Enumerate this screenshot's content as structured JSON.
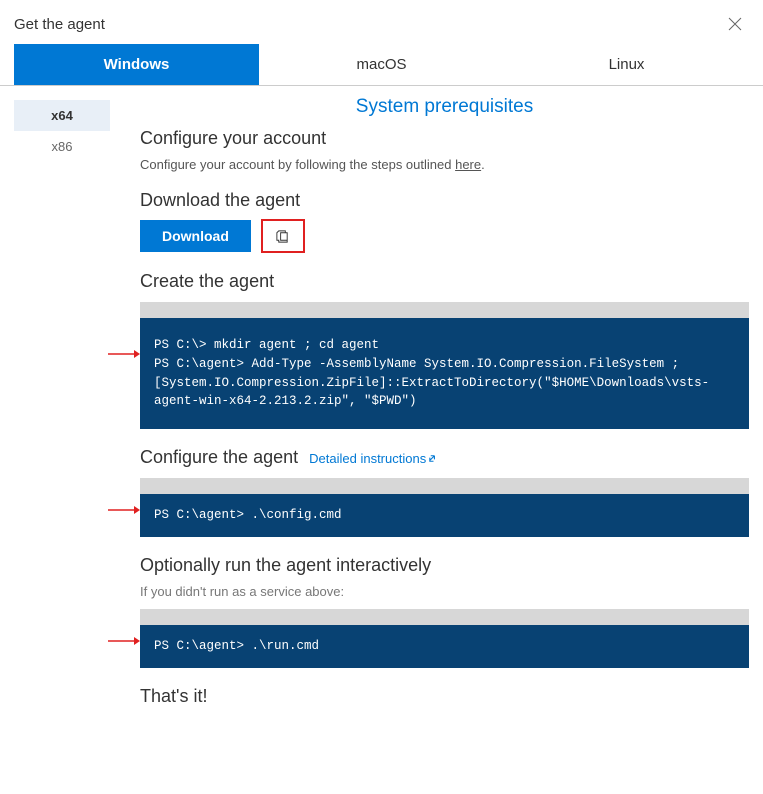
{
  "header": {
    "title": "Get the agent"
  },
  "tabs": {
    "windows": "Windows",
    "macos": "macOS",
    "linux": "Linux"
  },
  "arch": {
    "x64": "x64",
    "x86": "x86"
  },
  "prereq_title": "System prerequisites",
  "configure_account": {
    "title": "Configure your account",
    "text_pre": "Configure your account by following the steps outlined ",
    "link": "here",
    "text_post": "."
  },
  "download": {
    "title": "Download the agent",
    "button": "Download"
  },
  "create": {
    "title": "Create the agent",
    "code": "PS C:\\> mkdir agent ; cd agent\nPS C:\\agent> Add-Type -AssemblyName System.IO.Compression.FileSystem ; [System.IO.Compression.ZipFile]::ExtractToDirectory(\"$HOME\\Downloads\\vsts-agent-win-x64-2.213.2.zip\", \"$PWD\")"
  },
  "configure": {
    "title": "Configure the agent",
    "details_link": "Detailed instructions",
    "code": "PS C:\\agent> .\\config.cmd"
  },
  "run": {
    "title": "Optionally run the agent interactively",
    "note": "If you didn't run as a service above:",
    "code": "PS C:\\agent> .\\run.cmd"
  },
  "done": {
    "title": "That's it!"
  }
}
